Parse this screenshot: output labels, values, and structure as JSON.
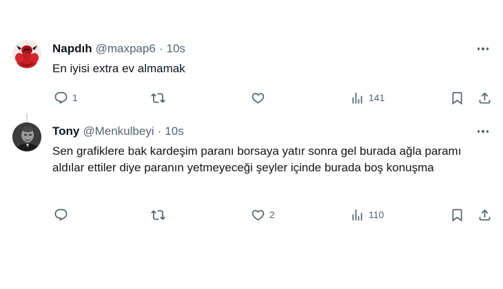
{
  "tweets": [
    {
      "name": "Napdıh",
      "handle": "@maxpap6",
      "separator": "·",
      "time": "10s",
      "text": "En iyisi extra ev almamak",
      "avatar_icon": "red-muscle-character-avatar",
      "replies": "1",
      "retweets": "",
      "likes": "",
      "views": "141"
    },
    {
      "name": "Tony",
      "handle": "@Menkulbeyi",
      "separator": "·",
      "time": "10s",
      "text": "Sen grafiklere bak kardeşim paranı borsaya yatır sonra gel burada ağla paramı aldılar ettiler diye paranın yetmeyeceği şeyler içinde burada boş konuşma",
      "avatar_icon": "grayscale-man-photo-avatar",
      "replies": "",
      "retweets": "",
      "likes": "2",
      "views": "110"
    }
  ],
  "icons": {
    "reply": "reply-icon",
    "retweet": "retweet-icon",
    "like": "like-icon",
    "views": "views-icon",
    "bookmark": "bookmark-icon",
    "share": "share-icon",
    "more": "more-icon"
  },
  "colors": {
    "text": "#0f1419",
    "secondary": "#536471",
    "thread_line": "#cfd9de",
    "background": "#ffffff"
  }
}
